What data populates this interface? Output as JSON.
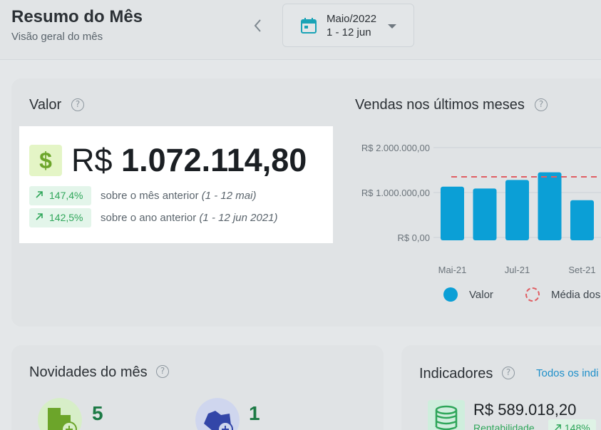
{
  "header": {
    "title": "Resumo do Mês",
    "subtitle": "Visão geral do mês",
    "period": {
      "month": "Maio/2022",
      "range": "1 - 12 jun"
    }
  },
  "valor": {
    "title": "Valor",
    "currency": "R$",
    "amount": "1.072.114,80",
    "comparisons": [
      {
        "delta": "147,4%",
        "text": "sobre o mês anterior",
        "period": "(1 - 12 mai)"
      },
      {
        "delta": "142,5%",
        "text": "sobre o ano anterior",
        "period": "(1 - 12 jun 2021)"
      }
    ]
  },
  "sales": {
    "title": "Vendas nos últimos meses",
    "legend": {
      "value": "Valor",
      "average": "Média dos"
    }
  },
  "chart_data": {
    "type": "bar",
    "title": "Vendas nos últimos meses",
    "yticks": [
      "R$ 2.000.000,00",
      "R$ 1.000.000,00",
      "R$ 0,00"
    ],
    "xticks": [
      "Mai-21",
      "Jul-21",
      "Set-21"
    ],
    "ylim": [
      0,
      2000000
    ],
    "values": [
      1130000,
      1090000,
      1280000,
      1450000,
      830000
    ],
    "average": 1350000,
    "bar_color": "#0b9fd6",
    "average_color": "#e05e63"
  },
  "news": {
    "title": "Novidades do mês",
    "items": [
      {
        "count": "5"
      },
      {
        "count": "1"
      }
    ]
  },
  "indicators": {
    "title": "Indicadores",
    "link": "Todos os indi",
    "value": "R$ 589.018,20",
    "label": "Rentabilidade",
    "badge": "148%"
  },
  "colors": {
    "accent": "#0b9fd6",
    "positive": "#2fa65a",
    "dollar": "#6ca52a"
  }
}
